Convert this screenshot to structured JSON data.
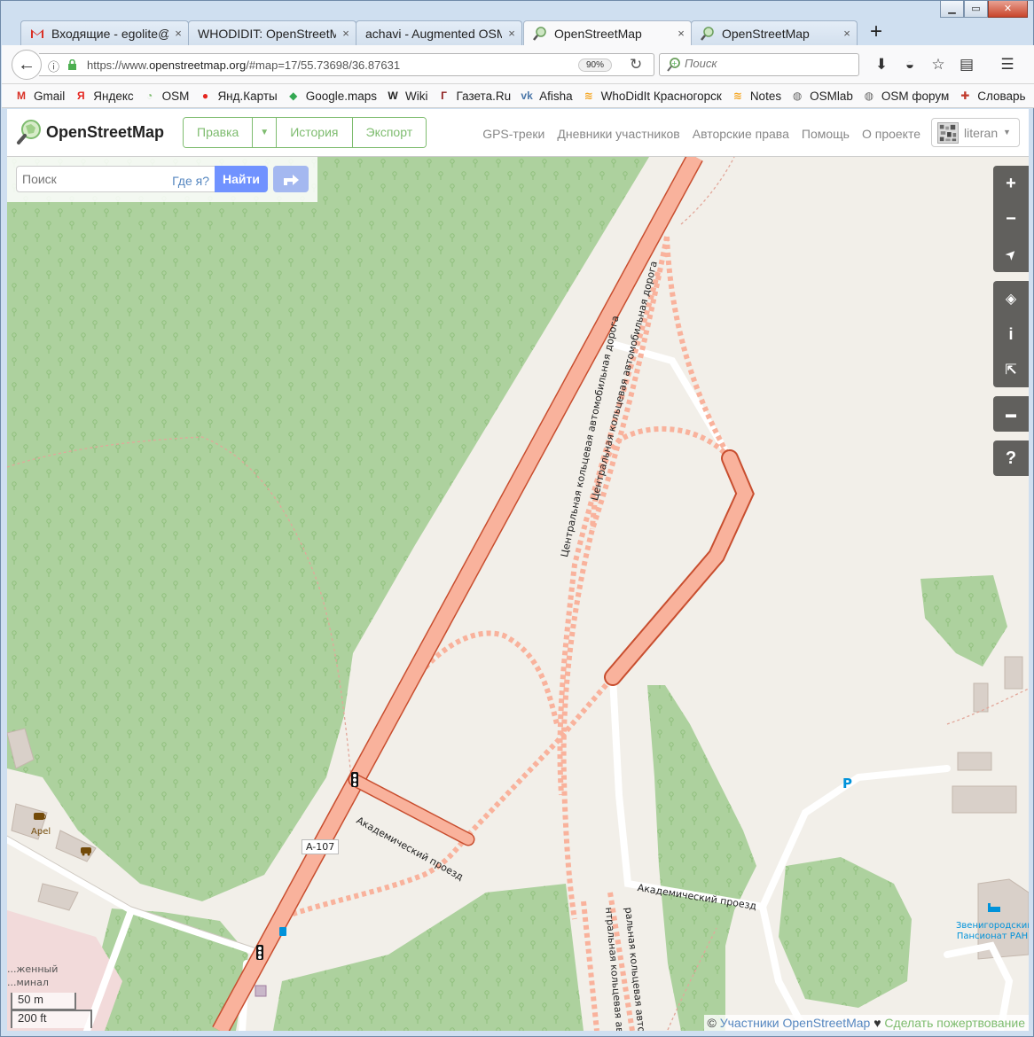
{
  "window": {
    "min_label": "▁",
    "max_label": "▭",
    "close_label": "✕"
  },
  "tabs": [
    {
      "title": "Входящие - egolite@",
      "icon": "gmail-icon",
      "active": false
    },
    {
      "title": "WHODIDIT: OpenStreetMa",
      "icon": "none",
      "active": false
    },
    {
      "title": "achavi - Augmented OSM",
      "icon": "none",
      "active": false
    },
    {
      "title": "OpenStreetMap",
      "icon": "osm-icon",
      "active": true
    },
    {
      "title": "OpenStreetMap",
      "icon": "osm-icon",
      "active": false
    }
  ],
  "tab_close_label": "×",
  "new_tab_label": "+",
  "navbar": {
    "back_label": "←",
    "info_label": "ⓘ",
    "url_prefix": "https://www.",
    "url_domain": "openstreetmap.org",
    "url_suffix": "/#map=17/55.73698/36.87631",
    "zoom": "90%",
    "reload_label": "↻",
    "search_placeholder": "Поиск"
  },
  "toolbar": {
    "download_icon": "⬇",
    "shield_icon": "◒",
    "star_icon": "☆",
    "reader_icon": "▤",
    "menu_icon": "☰"
  },
  "bookmarks": [
    {
      "label": "Gmail",
      "glyph": "M",
      "color": "#d93025"
    },
    {
      "label": "Яндекс",
      "glyph": "Я",
      "color": "#e52620"
    },
    {
      "label": "OSM",
      "glyph": "◔",
      "color": "#7ebc6f"
    },
    {
      "label": "Янд.Карты",
      "glyph": "●",
      "color": "#e52620"
    },
    {
      "label": "Google.maps",
      "glyph": "◆",
      "color": "#34a853"
    },
    {
      "label": "Wiki",
      "glyph": "W",
      "color": "#222222"
    },
    {
      "label": "Газета.Ru",
      "glyph": "Г",
      "color": "#8b1a1a"
    },
    {
      "label": "Afisha",
      "glyph": "vk",
      "color": "#4a76a8"
    },
    {
      "label": "WhoDidIt Красногорск",
      "glyph": "≋",
      "color": "#f5a623"
    },
    {
      "label": "Notes",
      "glyph": "≋",
      "color": "#f5a623"
    },
    {
      "label": "OSMlab",
      "glyph": "◍",
      "color": "#666666"
    },
    {
      "label": "OSM форум",
      "glyph": "◍",
      "color": "#666666"
    },
    {
      "label": "Словарь",
      "glyph": "✚",
      "color": "#c0392b"
    }
  ],
  "osm": {
    "site_name": "OpenStreetMap",
    "buttons": {
      "edit": "Правка",
      "caret": "▼",
      "history": "История",
      "export": "Экспорт"
    },
    "nav": [
      "GPS-треки",
      "Дневники участников",
      "Авторские права",
      "Помощь",
      "О проекте"
    ],
    "user": "literan",
    "user_caret": "▼",
    "search_placeholder": "Поиск",
    "where_am_i": "Где я?",
    "find": "Найти"
  },
  "map_controls": {
    "zoom_in": "+",
    "zoom_out": "−",
    "locate": "➤",
    "layers": "◈",
    "info": "i",
    "share": "⇱",
    "note": "▬",
    "help": "?"
  },
  "map_labels": {
    "road_a107": "A-107",
    "akad_proezd_1": "Академический проезд",
    "akad_proezd_2": "Академический проезд",
    "ring_road_1": "Центральная кольцевая автомобильная дорога",
    "ring_road_2": "Центральная кольцевая автомобильная дорога",
    "ring_road_3": "нтральная кольцевая авто",
    "ring_road_4": "ральная кольцевая автом",
    "cafe": "Apel",
    "parking": "P",
    "pension": "Звенигородский Пансионат РАН",
    "terminal_1": "...женный",
    "terminal_2": "...минал"
  },
  "scale": {
    "metric": "50 m",
    "imperial": "200 ft"
  },
  "attribution": {
    "copy": "©",
    "contributors": "Участники OpenStreetMap",
    "heart": "♥",
    "donate": "Сделать пожертвование"
  },
  "colors": {
    "forest": "#add19e",
    "land": "#f2efe9",
    "trunk": "#f9b29c",
    "trunk_casing": "#c84e2f",
    "osm_green": "#7ebc6f",
    "link_blue": "#5687c0",
    "find_blue": "#7092ff"
  }
}
